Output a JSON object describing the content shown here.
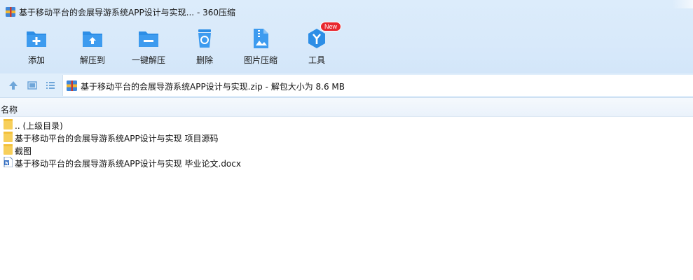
{
  "window": {
    "title": "基于移动平台的会展导游系统APP设计与实现... - 360压缩"
  },
  "toolbar": {
    "buttons": [
      {
        "label": "添加",
        "icon": "add-folder-icon"
      },
      {
        "label": "解压到",
        "icon": "extract-to-icon"
      },
      {
        "label": "一键解压",
        "icon": "one-click-extract-icon"
      },
      {
        "label": "删除",
        "icon": "recycle-bin-icon"
      },
      {
        "label": "图片压缩",
        "icon": "image-compress-icon"
      },
      {
        "label": "工具",
        "icon": "tools-icon"
      }
    ],
    "badge": "New"
  },
  "nav": {
    "address": "基于移动平台的会展导游系统APP设计与实现.zip - 解包大小为 8.6 MB"
  },
  "filelist": {
    "column_name": "名称",
    "rows": [
      {
        "name": ".. (上级目录)",
        "type": "folder"
      },
      {
        "name": "基于移动平台的会展导游系统APP设计与实现 项目源码",
        "type": "folder"
      },
      {
        "name": "截图",
        "type": "folder"
      },
      {
        "name": "基于移动平台的会展导游系统APP设计与实现 毕业论文.docx",
        "type": "docx"
      }
    ]
  },
  "colors": {
    "toolbar_blue": "#2d8ee6",
    "band": "#d8e9fa",
    "folder_yellow": "#f7cf5a",
    "badge_red": "#e8272e"
  }
}
